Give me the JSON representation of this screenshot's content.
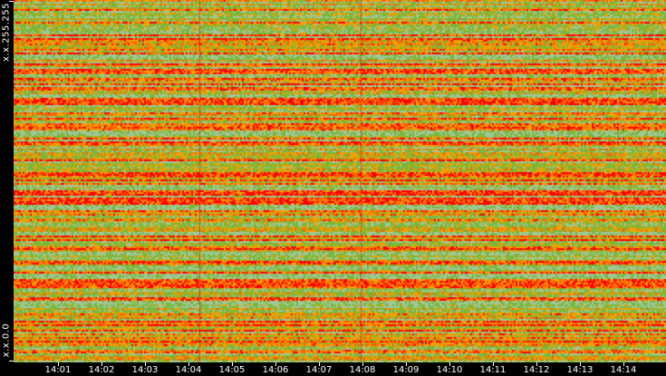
{
  "chart_data": {
    "type": "heatmap",
    "title": "",
    "xlabel": "",
    "ylabel": "",
    "x_range": [
      "14:00",
      "14:15"
    ],
    "x_ticks": [
      "14:01",
      "14:02",
      "14:03",
      "14:04",
      "14:05",
      "14:06",
      "14:07",
      "14:08",
      "14:09",
      "14:10",
      "14:11",
      "14:12",
      "14:13",
      "14:14"
    ],
    "y_range": [
      "x.x.0.0",
      "x.x.255.255"
    ],
    "y_labels": {
      "top": "x.x.255.255",
      "bottom": "x.x.0.0"
    },
    "color_scale": [
      "#9fc79a",
      "#7ab83a",
      "#f0a000",
      "#ff6000",
      "#ff0000"
    ],
    "grid": false
  }
}
